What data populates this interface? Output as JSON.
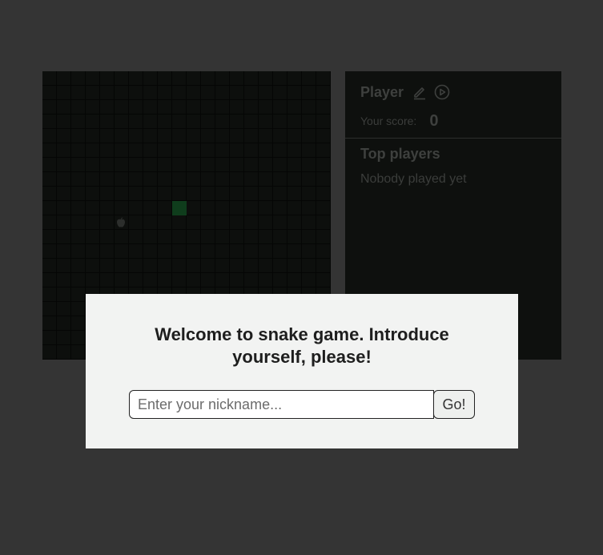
{
  "game": {
    "snake_length": 1,
    "apple_icon": "apple-icon",
    "snake_color": "#0f3d1c"
  },
  "panel": {
    "player_name": "Player",
    "edit_icon": "pencil-icon",
    "play_icon": "play-circle-icon",
    "score_label": "Your score:",
    "score_value": "0",
    "top_players_title": "Top players",
    "empty_message": "Nobody played yet"
  },
  "modal": {
    "title": "Welcome to snake game. Introduce yourself, please!",
    "input_placeholder": "Enter your nickname...",
    "input_value": "",
    "submit_label": "Go!"
  }
}
